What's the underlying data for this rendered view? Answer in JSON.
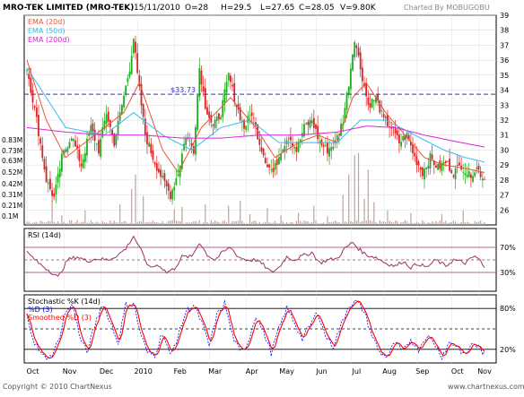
{
  "header": {
    "symbol": "MRO-TEK LIMITED (MRO-TEK)",
    "date": "15/11/2010",
    "open": "O=28",
    "high": "H=29.5",
    "low": "L=27.65",
    "close": "C=28.05",
    "volume": "V=9.80K",
    "credit": "Charted By MOBUGOBU"
  },
  "footer": {
    "copyright": "Copyright © 2010 ChartNexus",
    "website": "www.chartnexus.com"
  },
  "colors": {
    "up": "#22aa22",
    "down": "#dd2222",
    "ema20": "#ee5533",
    "ema50": "#33bbee",
    "ema200": "#dd22dd",
    "rsi": "#993366",
    "volume": "#b8a4a0",
    "stochK": "#0000ff",
    "stochD": "#ff0000",
    "grid": "#000000"
  },
  "chart_data": [
    {
      "type": "candlestick",
      "panel": "price",
      "legend": [
        "EMA (20d)",
        "EMA (50d)",
        "EMA (200d)"
      ],
      "ylim": [
        25,
        39
      ],
      "y_ticks": [
        26,
        27,
        28,
        29,
        30,
        31,
        32,
        33,
        34,
        35,
        36,
        37,
        38,
        39
      ],
      "x_months": [
        "Oct",
        "Nov",
        "Dec",
        "2010",
        "Feb",
        "Mar",
        "Apr",
        "May",
        "Jun",
        "Jul",
        "Aug",
        "Sep",
        "Oct",
        "Nov"
      ],
      "annotation": {
        "label": "$33.73",
        "value": 33.73
      },
      "close_anchors": [
        [
          0,
          35.5
        ],
        [
          5,
          32.0
        ],
        [
          10,
          28.0
        ],
        [
          14,
          26.8
        ],
        [
          18,
          29.5
        ],
        [
          23,
          31.0
        ],
        [
          28,
          29.0
        ],
        [
          33,
          31.5
        ],
        [
          37,
          30.0
        ],
        [
          41,
          32.5
        ],
        [
          45,
          30.5
        ],
        [
          49,
          33.0
        ],
        [
          53,
          35.5
        ],
        [
          55,
          37.5
        ],
        [
          57,
          35.0
        ],
        [
          61,
          31.0
        ],
        [
          65,
          29.5
        ],
        [
          70,
          28.0
        ],
        [
          74,
          27.0
        ],
        [
          78,
          28.5
        ],
        [
          82,
          31.0
        ],
        [
          86,
          30.0
        ],
        [
          89,
          35.5
        ],
        [
          92,
          33.0
        ],
        [
          96,
          31.5
        ],
        [
          100,
          32.5
        ],
        [
          104,
          35.0
        ],
        [
          108,
          33.0
        ],
        [
          112,
          31.5
        ],
        [
          116,
          32.5
        ],
        [
          120,
          30.5
        ],
        [
          124,
          29.0
        ],
        [
          127,
          28.5
        ],
        [
          131,
          30.0
        ],
        [
          135,
          31.0
        ],
        [
          139,
          30.0
        ],
        [
          143,
          31.5
        ],
        [
          147,
          32.0
        ],
        [
          151,
          30.5
        ],
        [
          155,
          30.0
        ],
        [
          159,
          30.5
        ],
        [
          163,
          32.0
        ],
        [
          166,
          34.5
        ],
        [
          169,
          37.5
        ],
        [
          172,
          35.5
        ],
        [
          176,
          33.0
        ],
        [
          180,
          33.5
        ],
        [
          184,
          32.0
        ],
        [
          188,
          31.5
        ],
        [
          192,
          30.5
        ],
        [
          196,
          31.0
        ],
        [
          200,
          29.5
        ],
        [
          204,
          28.5
        ],
        [
          208,
          29.5
        ],
        [
          212,
          28.8
        ],
        [
          216,
          29.2
        ],
        [
          220,
          28.5
        ],
        [
          224,
          29.0
        ],
        [
          228,
          28.3
        ],
        [
          232,
          28.8
        ],
        [
          236,
          28.05
        ]
      ],
      "series": [
        {
          "name": "EMA (20d)",
          "anchors": [
            [
              0,
              36.0
            ],
            [
              10,
              32.0
            ],
            [
              20,
              29.5
            ],
            [
              35,
              31.0
            ],
            [
              50,
              32.5
            ],
            [
              58,
              34.5
            ],
            [
              70,
              30.0
            ],
            [
              78,
              28.5
            ],
            [
              90,
              31.5
            ],
            [
              105,
              33.5
            ],
            [
              118,
              31.5
            ],
            [
              128,
              29.5
            ],
            [
              140,
              30.5
            ],
            [
              150,
              31.0
            ],
            [
              160,
              30.5
            ],
            [
              168,
              33.5
            ],
            [
              175,
              34.5
            ],
            [
              185,
              32.5
            ],
            [
              195,
              31.0
            ],
            [
              205,
              29.5
            ],
            [
              215,
              29.0
            ],
            [
              225,
              28.8
            ],
            [
              236,
              28.5
            ]
          ]
        },
        {
          "name": "EMA (50d)",
          "anchors": [
            [
              0,
              35.5
            ],
            [
              20,
              31.5
            ],
            [
              40,
              31.0
            ],
            [
              55,
              32.5
            ],
            [
              70,
              31.0
            ],
            [
              85,
              30.0
            ],
            [
              100,
              31.5
            ],
            [
              115,
              32.0
            ],
            [
              130,
              30.5
            ],
            [
              145,
              30.5
            ],
            [
              160,
              30.5
            ],
            [
              172,
              32.0
            ],
            [
              185,
              32.0
            ],
            [
              200,
              31.0
            ],
            [
              215,
              30.0
            ],
            [
              226,
              29.5
            ],
            [
              236,
              29.2
            ]
          ]
        },
        {
          "name": "EMA (200d)",
          "anchors": [
            [
              0,
              31.5
            ],
            [
              20,
              31.2
            ],
            [
              40,
              31.0
            ],
            [
              60,
              31.0
            ],
            [
              80,
              30.8
            ],
            [
              100,
              30.8
            ],
            [
              120,
              31.0
            ],
            [
              140,
              31.0
            ],
            [
              160,
              31.2
            ],
            [
              175,
              31.6
            ],
            [
              190,
              31.5
            ],
            [
              205,
              31.0
            ],
            [
              220,
              30.6
            ],
            [
              236,
              30.2
            ]
          ]
        }
      ]
    },
    {
      "type": "bar",
      "panel": "volume",
      "y_ticks": [
        "0.83M",
        "0.73M",
        "0.63M",
        "0.52M",
        "0.42M",
        "0.31M",
        "0.21M",
        "0.1M"
      ],
      "ylim": [
        0,
        0.88
      ],
      "spikes": [
        [
          13,
          0.2
        ],
        [
          18,
          0.08
        ],
        [
          30,
          0.12
        ],
        [
          48,
          0.17
        ],
        [
          54,
          0.3
        ],
        [
          56,
          0.42
        ],
        [
          60,
          0.24
        ],
        [
          76,
          0.13
        ],
        [
          80,
          0.15
        ],
        [
          92,
          0.17
        ],
        [
          104,
          0.16
        ],
        [
          110,
          0.2
        ],
        [
          115,
          0.09
        ],
        [
          124,
          0.14
        ],
        [
          131,
          0.08
        ],
        [
          140,
          0.1
        ],
        [
          148,
          0.16
        ],
        [
          155,
          0.07
        ],
        [
          163,
          0.25
        ],
        [
          166,
          0.42
        ],
        [
          169,
          0.58
        ],
        [
          171,
          0.6
        ],
        [
          174,
          0.22
        ],
        [
          176,
          0.46
        ],
        [
          179,
          0.19
        ],
        [
          186,
          0.12
        ],
        [
          198,
          0.1
        ],
        [
          214,
          0.09
        ],
        [
          225,
          0.12
        ]
      ]
    },
    {
      "type": "line",
      "panel": "rsi",
      "series_label": "RSI (14d)",
      "ylim": [
        0,
        100
      ],
      "y_ticks": [
        "70%",
        "30%"
      ],
      "levels": [
        70,
        50,
        30
      ],
      "anchors": [
        [
          0,
          62
        ],
        [
          6,
          45
        ],
        [
          12,
          32
        ],
        [
          16,
          22
        ],
        [
          21,
          50
        ],
        [
          26,
          55
        ],
        [
          31,
          48
        ],
        [
          36,
          52
        ],
        [
          42,
          50
        ],
        [
          47,
          58
        ],
        [
          51,
          68
        ],
        [
          55,
          88
        ],
        [
          58,
          70
        ],
        [
          63,
          38
        ],
        [
          68,
          42
        ],
        [
          72,
          30
        ],
        [
          76,
          36
        ],
        [
          80,
          55
        ],
        [
          85,
          55
        ],
        [
          89,
          78
        ],
        [
          93,
          58
        ],
        [
          97,
          50
        ],
        [
          101,
          62
        ],
        [
          105,
          70
        ],
        [
          109,
          55
        ],
        [
          113,
          50
        ],
        [
          118,
          50
        ],
        [
          122,
          42
        ],
        [
          126,
          30
        ],
        [
          130,
          38
        ],
        [
          134,
          55
        ],
        [
          138,
          50
        ],
        [
          142,
          56
        ],
        [
          147,
          62
        ],
        [
          151,
          45
        ],
        [
          155,
          50
        ],
        [
          160,
          52
        ],
        [
          164,
          68
        ],
        [
          168,
          78
        ],
        [
          171,
          68
        ],
        [
          175,
          58
        ],
        [
          180,
          54
        ],
        [
          185,
          45
        ],
        [
          190,
          40
        ],
        [
          194,
          48
        ],
        [
          198,
          38
        ],
        [
          202,
          44
        ],
        [
          206,
          38
        ],
        [
          211,
          50
        ],
        [
          216,
          40
        ],
        [
          220,
          50
        ],
        [
          226,
          45
        ],
        [
          231,
          56
        ],
        [
          234,
          48
        ],
        [
          236,
          36
        ]
      ]
    },
    {
      "type": "line",
      "panel": "stochastic",
      "series_labels": [
        "Stochastic %K (14d)",
        "%D (3)",
        "Smoothed %D (3)"
      ],
      "ylim": [
        0,
        100
      ],
      "y_ticks": [
        "80%",
        "20%"
      ],
      "levels": [
        80,
        50,
        20
      ],
      "anchors": [
        [
          0,
          70
        ],
        [
          4,
          30
        ],
        [
          8,
          10
        ],
        [
          12,
          8
        ],
        [
          16,
          30
        ],
        [
          20,
          75
        ],
        [
          24,
          85
        ],
        [
          27,
          40
        ],
        [
          31,
          15
        ],
        [
          35,
          55
        ],
        [
          39,
          88
        ],
        [
          43,
          60
        ],
        [
          47,
          30
        ],
        [
          51,
          85
        ],
        [
          55,
          88
        ],
        [
          58,
          50
        ],
        [
          62,
          15
        ],
        [
          66,
          12
        ],
        [
          70,
          45
        ],
        [
          74,
          10
        ],
        [
          78,
          40
        ],
        [
          82,
          75
        ],
        [
          86,
          85
        ],
        [
          90,
          60
        ],
        [
          94,
          25
        ],
        [
          98,
          70
        ],
        [
          102,
          88
        ],
        [
          106,
          40
        ],
        [
          110,
          15
        ],
        [
          114,
          30
        ],
        [
          118,
          70
        ],
        [
          122,
          45
        ],
        [
          126,
          15
        ],
        [
          130,
          50
        ],
        [
          134,
          80
        ],
        [
          138,
          60
        ],
        [
          142,
          35
        ],
        [
          146,
          55
        ],
        [
          150,
          75
        ],
        [
          154,
          40
        ],
        [
          158,
          25
        ],
        [
          162,
          55
        ],
        [
          166,
          85
        ],
        [
          170,
          90
        ],
        [
          174,
          75
        ],
        [
          178,
          40
        ],
        [
          182,
          15
        ],
        [
          186,
          10
        ],
        [
          190,
          30
        ],
        [
          194,
          15
        ],
        [
          198,
          35
        ],
        [
          202,
          20
        ],
        [
          206,
          40
        ],
        [
          210,
          30
        ],
        [
          214,
          10
        ],
        [
          218,
          30
        ],
        [
          222,
          25
        ],
        [
          226,
          10
        ],
        [
          230,
          30
        ],
        [
          234,
          20
        ],
        [
          236,
          12
        ]
      ]
    }
  ]
}
